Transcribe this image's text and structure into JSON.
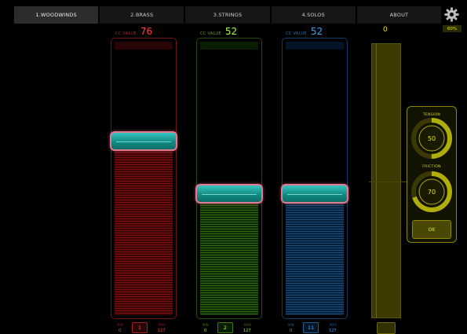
{
  "tabs": [
    {
      "label": "1.WOODWINDS",
      "active": true
    },
    {
      "label": "2.BRASS",
      "active": false
    },
    {
      "label": "3.STRINGS",
      "active": false
    },
    {
      "label": "4.SOLOS",
      "active": false
    },
    {
      "label": "ABOUT",
      "active": false
    }
  ],
  "icons": {
    "settings": "gear-icon"
  },
  "battery": "60%",
  "faders": [
    {
      "cc_label": "CC VALUE",
      "cc_value": "76",
      "color": "#ff3c3c",
      "level": 0.6,
      "min_label": "MIN",
      "min": "0",
      "max_label": "MAX",
      "max": "127",
      "channel": "1"
    },
    {
      "cc_label": "CC VALUE",
      "cc_value": "52",
      "color": "#aaff33",
      "level": 0.41,
      "min_label": "MIN",
      "min": "0",
      "max_label": "MAX",
      "max": "127",
      "channel": "2"
    },
    {
      "cc_label": "CC VALUE",
      "cc_value": "52",
      "color": "#33a8ff",
      "level": 0.41,
      "min_label": "MIN",
      "min": "0",
      "max_label": "MAX",
      "max": "127",
      "channel": "11"
    }
  ],
  "expression": {
    "value": "0",
    "color": "#e8e800"
  },
  "panel": {
    "tension_label": "TENSION",
    "tension_value": "50",
    "tension_level": 0.5,
    "friction_label": "FRICTION",
    "friction_value": "70",
    "friction_level": 0.7,
    "ok_label": "OK"
  }
}
